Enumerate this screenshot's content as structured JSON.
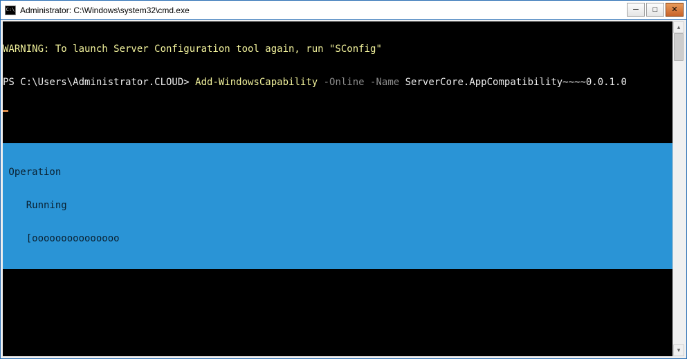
{
  "window": {
    "title": "Administrator: C:\\Windows\\system32\\cmd.exe",
    "controls": {
      "minimize": "─",
      "maximize": "□",
      "close": "✕"
    }
  },
  "terminal": {
    "warning_line": "WARNING: To launch Server Configuration tool again, run \"SConfig\"",
    "prompt": "PS C:\\Users\\Administrator.CLOUD> ",
    "cmd_name": "Add-WindowsCapability ",
    "cmd_param1": "-Online ",
    "cmd_param2": "-Name ",
    "cmd_value": "ServerCore.AppCompatibility~~~~0.0.1.0"
  },
  "progress": {
    "label": " Operation",
    "status": "    Running",
    "bar": "    [ooooooooooooooo                                                                                                    ]"
  },
  "scrollbar": {
    "up": "▴",
    "down": "▾"
  }
}
